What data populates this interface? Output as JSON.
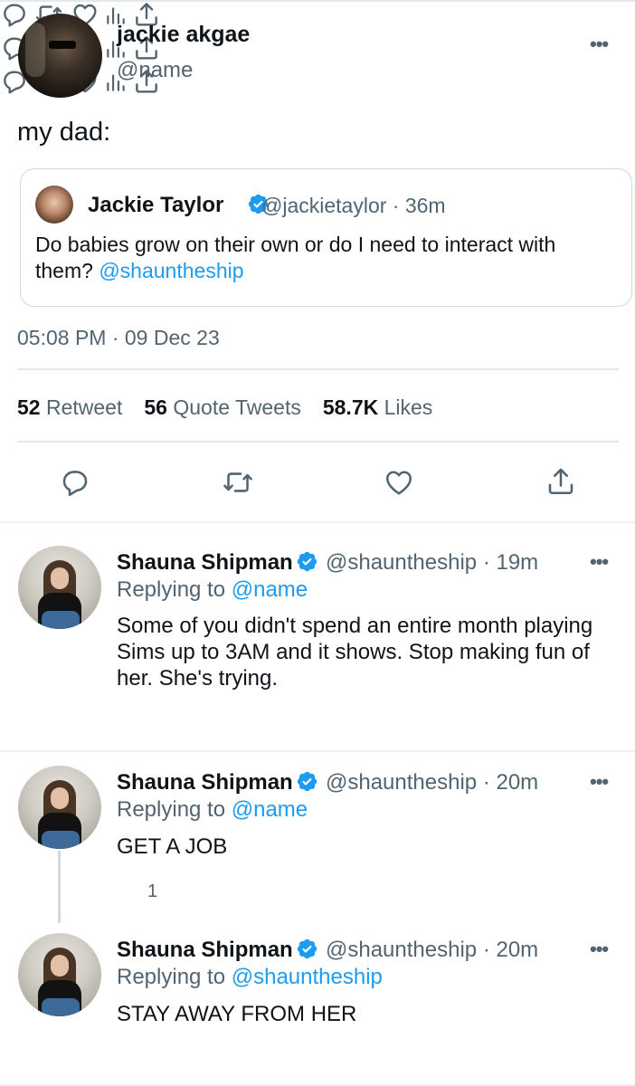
{
  "main_tweet": {
    "display_name": "jackie akgae",
    "handle": "@name",
    "text": "my dad:",
    "more_icon": "more-dots-icon",
    "quoted": {
      "display_name": "Jackie Taylor",
      "verified": true,
      "meta": "@jackietaylor · 36m",
      "text": "Do babies grow on their own or do I need to interact with them?",
      "mention": "@shauntheship"
    },
    "timestamp": "05:08 PM · 09 Dec 23",
    "stats": {
      "retweets_count": "52",
      "retweets_label": "Retweet",
      "quotes_count": "56",
      "quotes_label": "Quote Tweets",
      "likes_count": "58.7K",
      "likes_label": "Likes"
    }
  },
  "replies": [
    {
      "display_name": "Shauna Shipman",
      "verified": true,
      "meta": "@shauntheship · 19m",
      "replying_prefix": "Replying to",
      "replying_to": "@name",
      "text": "Some of you didn't spend an entire month playing Sims up to 3AM and it shows. Stop making fun of her. She's trying.",
      "reply_count": ""
    },
    {
      "display_name": "Shauna Shipman",
      "verified": true,
      "meta": "@shauntheship · 20m",
      "replying_prefix": "Replying to",
      "replying_to": "@name",
      "text": "GET A JOB",
      "reply_count": "1"
    },
    {
      "display_name": "Shauna Shipman",
      "verified": true,
      "meta": "@shauntheship · 20m",
      "replying_prefix": "Replying to",
      "replying_to": "@shauntheship",
      "text": "STAY AWAY FROM HER",
      "reply_count": ""
    }
  ],
  "colors": {
    "link": "#1d9bf0",
    "secondary_text": "#536471",
    "primary_text": "#0f1419",
    "divider": "#e4e8eb"
  }
}
